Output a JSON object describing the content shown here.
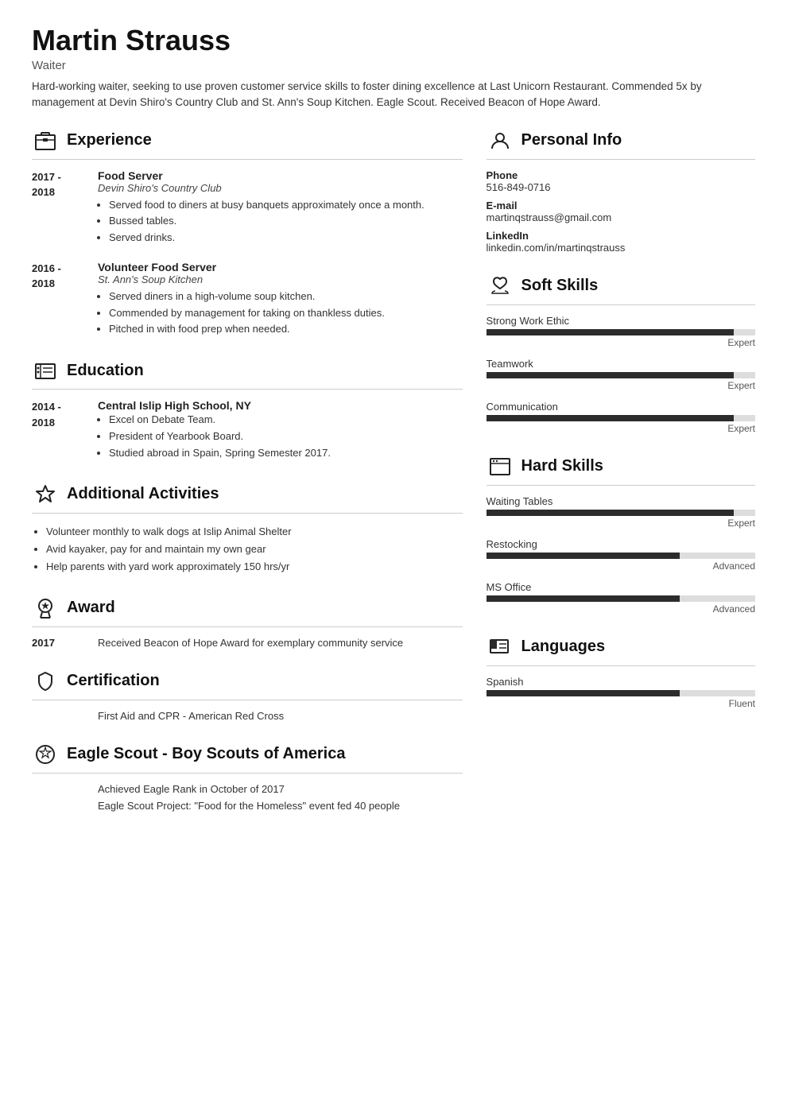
{
  "header": {
    "name": "Martin Strauss",
    "title": "Waiter",
    "summary": "Hard-working waiter, seeking to use proven customer service skills to foster dining excellence at Last Unicorn Restaurant. Commended 5x by management at Devin Shiro's Country Club and St. Ann's Soup Kitchen. Eagle Scout. Received Beacon of Hope Award."
  },
  "experience": {
    "section_title": "Experience",
    "entries": [
      {
        "date_start": "2017 -",
        "date_end": "2018",
        "job_title": "Food Server",
        "company": "Devin Shiro's Country Club",
        "bullets": [
          "Served food to diners at busy banquets approximately once a month.",
          "Bussed tables.",
          "Served drinks."
        ]
      },
      {
        "date_start": "2016 -",
        "date_end": "2018",
        "job_title": "Volunteer Food Server",
        "company": "St. Ann's Soup Kitchen",
        "bullets": [
          "Served diners in a high-volume soup kitchen.",
          "Commended by management for taking on thankless duties.",
          "Pitched in with food prep when needed."
        ]
      }
    ]
  },
  "education": {
    "section_title": "Education",
    "entries": [
      {
        "date_start": "2014 -",
        "date_end": "2018",
        "school": "Central Islip High School, NY",
        "bullets": [
          "Excel on Debate Team.",
          "President of Yearbook Board.",
          "Studied abroad in Spain, Spring Semester 2017."
        ]
      }
    ]
  },
  "additional_activities": {
    "section_title": "Additional Activities",
    "items": [
      "Volunteer monthly to walk dogs at Islip Animal Shelter",
      "Avid kayaker, pay for and maintain my own gear",
      "Help parents with yard work approximately 150 hrs/yr"
    ]
  },
  "award": {
    "section_title": "Award",
    "entries": [
      {
        "year": "2017",
        "text": "Received Beacon of Hope Award for exemplary community service"
      }
    ]
  },
  "certification": {
    "section_title": "Certification",
    "text": "First Aid and CPR - American Red Cross"
  },
  "eagle_scout": {
    "section_title": "Eagle Scout - Boy Scouts of America",
    "lines": [
      "Achieved Eagle Rank in October of 2017",
      "Eagle Scout Project: \"Food for the Homeless\" event fed 40 people"
    ]
  },
  "personal_info": {
    "section_title": "Personal Info",
    "phone_label": "Phone",
    "phone": "516-849-0716",
    "email_label": "E-mail",
    "email": "martinqstrauss@gmail.com",
    "linkedin_label": "LinkedIn",
    "linkedin": "linkedin.com/in/martinqstrauss"
  },
  "soft_skills": {
    "section_title": "Soft Skills",
    "skills": [
      {
        "name": "Strong Work Ethic",
        "level": "Expert",
        "percent": 92
      },
      {
        "name": "Teamwork",
        "level": "Expert",
        "percent": 92
      },
      {
        "name": "Communication",
        "level": "Expert",
        "percent": 92
      }
    ]
  },
  "hard_skills": {
    "section_title": "Hard Skills",
    "skills": [
      {
        "name": "Waiting Tables",
        "level": "Expert",
        "percent": 92
      },
      {
        "name": "Restocking",
        "level": "Advanced",
        "percent": 72
      },
      {
        "name": "MS Office",
        "level": "Advanced",
        "percent": 72
      }
    ]
  },
  "languages": {
    "section_title": "Languages",
    "items": [
      {
        "name": "Spanish",
        "level": "Fluent",
        "percent": 72
      }
    ]
  }
}
